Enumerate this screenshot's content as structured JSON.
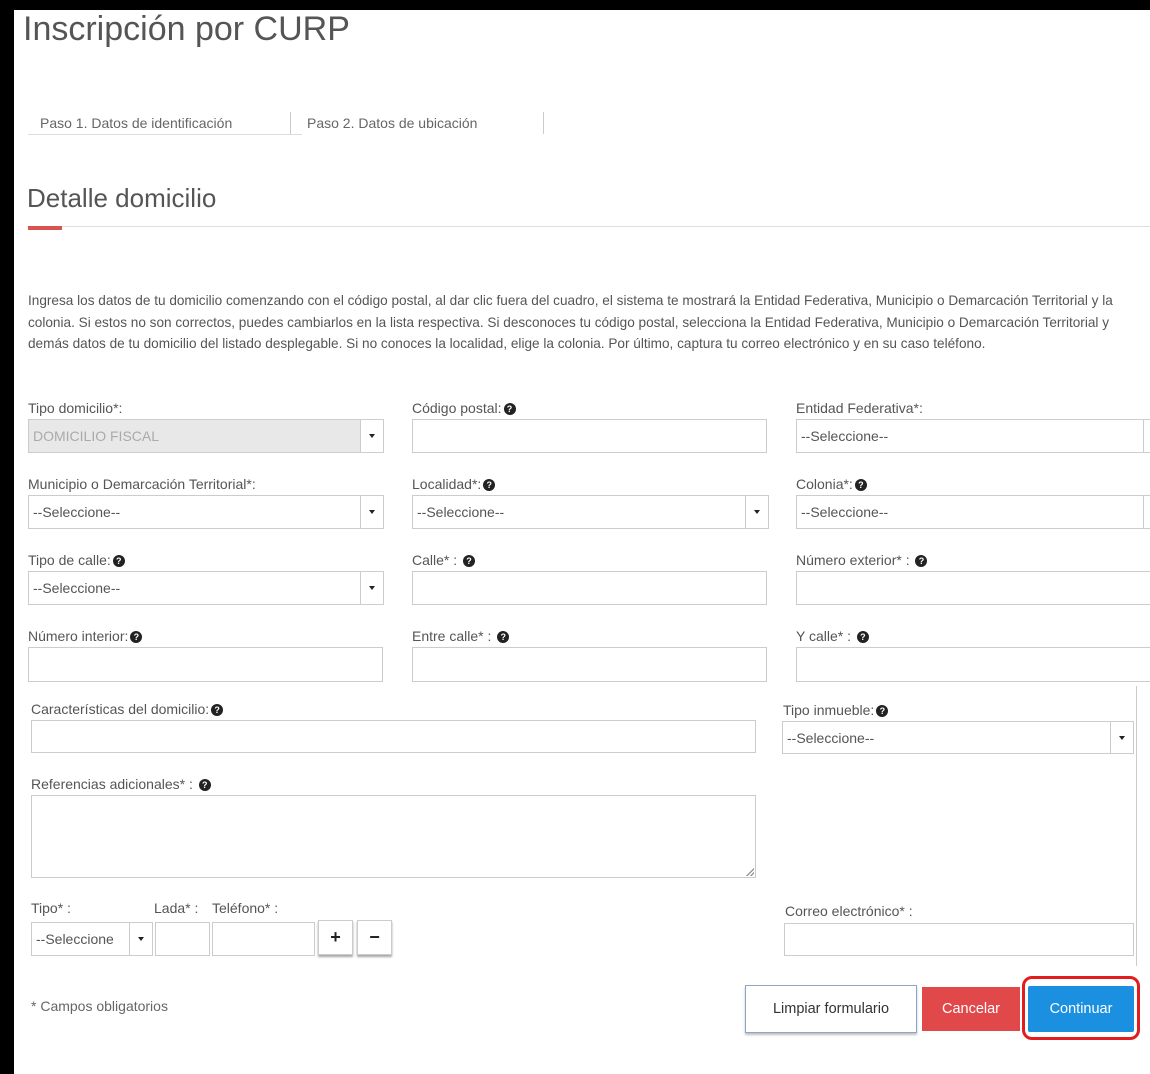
{
  "page": {
    "title": "Inscripción por CURP",
    "tabs": [
      "Paso 1. Datos de identificación",
      "Paso 2. Datos de ubicación"
    ],
    "section_title": "Detalle domicilio",
    "intro": "Ingresa los datos de tu domicilio comenzando con el código postal, al dar clic fuera del cuadro, el sistema te mostrará la Entidad Federativa, Municipio o Demarcación Territorial y la colonia. Si estos no son correctos, puedes cambiarlos en la lista respectiva. Si desconoces tu código postal, selecciona la Entidad Federativa, Municipio o Demarcación Territorial y demás datos de tu domicilio del listado desplegable. Si no conoces la localidad, elige la colonia. Por último, captura tu correo electrónico y en su caso teléfono."
  },
  "form": {
    "tipo_domicilio_label": "Tipo domicilio*:",
    "tipo_domicilio_value": "DOMICILIO FISCAL",
    "codigo_postal_label": "Código postal:",
    "entidad_label": "Entidad Federativa*:",
    "select_placeholder": "--Seleccione--",
    "municipio_label": "Municipio o Demarcación Territorial*:",
    "localidad_label": "Localidad*:",
    "colonia_label": "Colonia*:",
    "tipo_calle_label": "Tipo de calle:",
    "calle_label": "Calle* :",
    "numero_exterior_label": "Número exterior* :",
    "numero_interior_label": "Número interior:",
    "entre_calle_label": "Entre calle* :",
    "y_calle_label": "Y calle* :",
    "caracteristicas_label": "Características del domicilio:",
    "tipo_inmueble_label": "Tipo inmueble:",
    "referencias_label": "Referencias adicionales* :",
    "tipo_tel_label": "Tipo* :",
    "tipo_tel_value": "--Seleccione",
    "lada_label": "Lada* :",
    "telefono_label": "Teléfono* :",
    "add_symbol": "+",
    "remove_symbol": "−",
    "correo_label": "Correo electrónico* :",
    "required_note": "* Campos obligatorios"
  },
  "buttons": {
    "clear": "Limpiar formulario",
    "cancel": "Cancelar",
    "continue": "Continuar"
  },
  "colors": {
    "cancel": "#e0484a",
    "continue": "#1b8fe0",
    "highlight": "#e31d1d",
    "accent_bar": "#d9534f"
  },
  "icons": {
    "help": "question-circle-icon"
  }
}
